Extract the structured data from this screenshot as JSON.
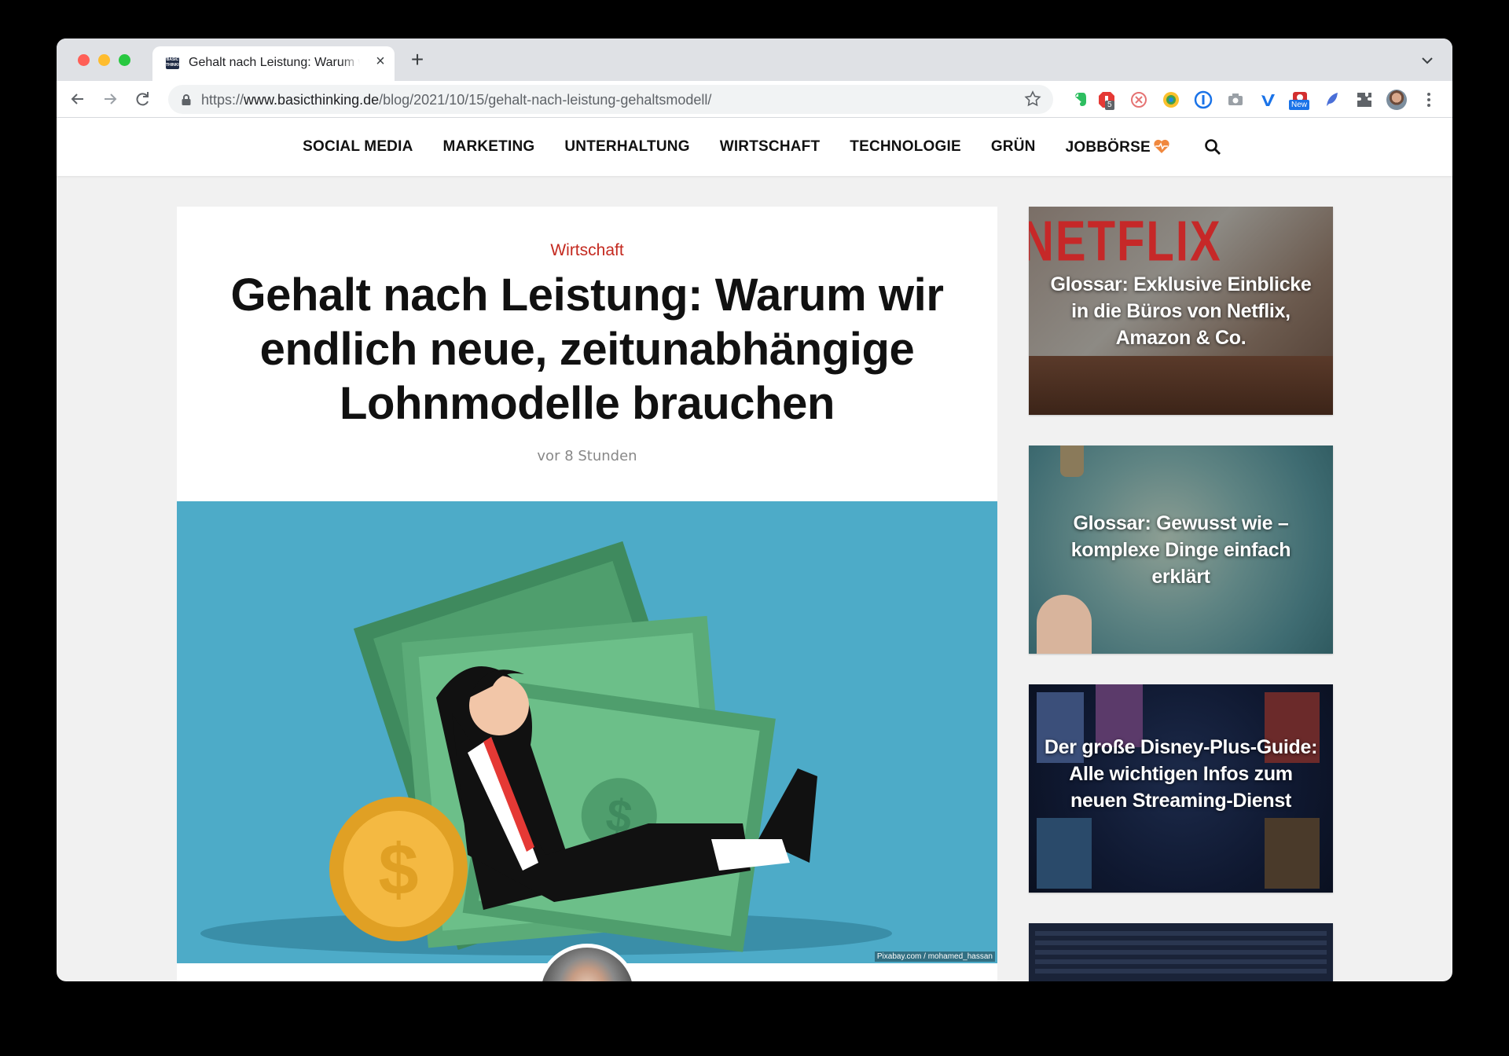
{
  "browser": {
    "tab_title": "Gehalt nach Leistung: Warum wir endlich neue, zeitunabhängige Lohnmodelle brauchen",
    "favicon_text": "BASIC THINKING",
    "url_prefix": "https://",
    "url_host": "www.basicthinking.de",
    "url_path": "/blog/2021/10/15/gehalt-nach-leistung-gehaltsmodell/",
    "extension_badges": [
      "5",
      "New"
    ],
    "icons": [
      "back-icon",
      "forward-icon",
      "reload-icon",
      "lock-icon",
      "star-icon",
      "extensions-icon",
      "menu-icon"
    ]
  },
  "sitenav": {
    "items": [
      "SOCIAL MEDIA",
      "MARKETING",
      "UNTERHALTUNG",
      "WIRTSCHAFT",
      "TECHNOLOGIE",
      "GRÜN",
      "JOBBÖRSE"
    ],
    "jobboerse_icon": "heart-pulse-icon",
    "search_icon": "search-icon"
  },
  "article": {
    "category": "Wirtschaft",
    "headline": "Gehalt nach Leistung: Warum wir endlich neue, zeitunabhängige Lohnmodelle brauchen",
    "date": "vor 8 Stunden",
    "image_credit": "Pixabay.com / mohamed_hassan"
  },
  "sidebar": {
    "cards": [
      {
        "title": "Glossar: Exklusive Einblicke in die Büros von Netflix, Amazon & Co.",
        "bg_text": "NETFLIX"
      },
      {
        "title": "Glossar: Gewusst wie – komplexe Dinge einfach erklärt"
      },
      {
        "title": "Der große Disney-Plus-Guide: Alle wichtigen Infos zum neuen Streaming-Dienst"
      },
      {
        "title": ""
      }
    ]
  },
  "colors": {
    "accent_red": "#c4291f",
    "hero_bg": "#4dabc8",
    "heart": "#f0883e"
  }
}
